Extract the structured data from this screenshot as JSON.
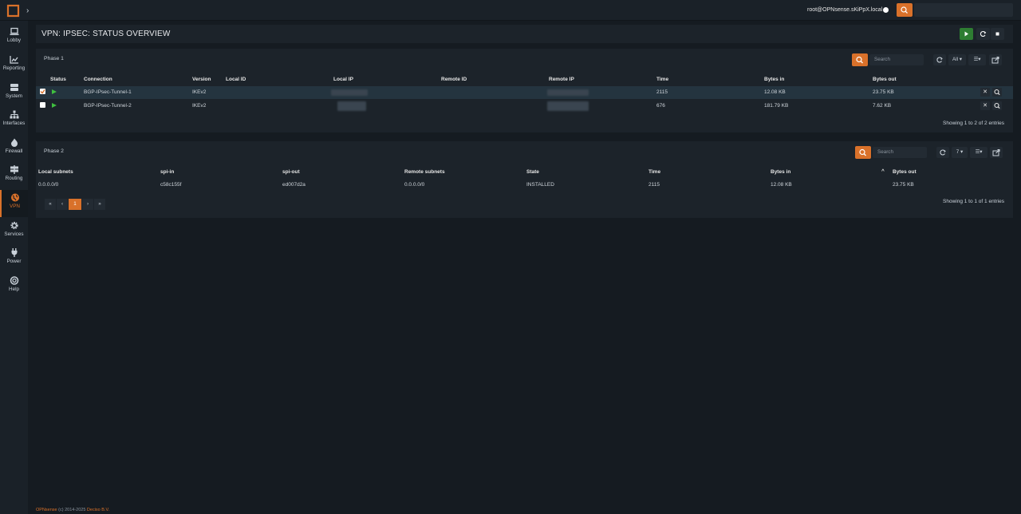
{
  "topbar": {
    "user": "root@OPNsense.sKiPpX.local",
    "search_placeholder": ""
  },
  "sidebar": {
    "items": [
      {
        "label": "Lobby",
        "icon": "laptop-icon"
      },
      {
        "label": "Reporting",
        "icon": "chart-icon"
      },
      {
        "label": "System",
        "icon": "server-icon"
      },
      {
        "label": "Interfaces",
        "icon": "sitemap-icon"
      },
      {
        "label": "Firewall",
        "icon": "fire-icon"
      },
      {
        "label": "Routing",
        "icon": "signpost-icon"
      },
      {
        "label": "VPN",
        "icon": "globe-icon"
      },
      {
        "label": "Services",
        "icon": "gear-icon"
      },
      {
        "label": "Power",
        "icon": "plug-icon"
      },
      {
        "label": "Help",
        "icon": "lifebuoy-icon"
      }
    ]
  },
  "page": {
    "title": "VPN: IPSEC: STATUS OVERVIEW"
  },
  "phase1": {
    "title": "Phase 1",
    "search_placeholder": "Search",
    "rows_filter": "All",
    "columns": [
      "Status",
      "Connection",
      "Version",
      "Local ID",
      "Local IP",
      "Remote ID",
      "Remote IP",
      "Time",
      "Bytes in",
      "Bytes out"
    ],
    "rows": [
      {
        "connection": "BGP-IPsec-Tunnel-1",
        "version": "IKEv2",
        "time": "2115",
        "bytes_in": "12.08 KB",
        "bytes_out": "23.75 KB",
        "selected": true
      },
      {
        "connection": "BGP-IPsec-Tunnel-2",
        "version": "IKEv2",
        "time": "676",
        "bytes_in": "181.79 KB",
        "bytes_out": "7.62 KB",
        "selected": false
      }
    ],
    "showing": "Showing 1 to 2 of 2 entries"
  },
  "phase2": {
    "title": "Phase 2",
    "search_placeholder": "Search",
    "rows_filter": "7",
    "columns": [
      "Local subnets",
      "spi-in",
      "spi-out",
      "Remote subnets",
      "State",
      "Time",
      "Bytes in",
      "Bytes out"
    ],
    "rows": [
      {
        "local_subnets": "0.0.0.0/0",
        "spi_in": "c58c155f",
        "spi_out": "ed007d2a",
        "remote_subnets": "0.0.0.0/0",
        "state": "INSTALLED",
        "time": "2115",
        "bytes_in": "12.08 KB",
        "bytes_out": "23.75 KB"
      }
    ],
    "pagination": {
      "first": "«",
      "prev": "‹",
      "current": "1",
      "next": "›",
      "last": "»"
    },
    "showing": "Showing 1 to 1 of 1 entries"
  },
  "footer": {
    "brand": "OPNsense",
    "text": " (c) 2014-2025 ",
    "company": "Deciso B.V."
  },
  "colors": {
    "accent": "#d9712a",
    "success": "#2e7d32",
    "background": "#151b21"
  }
}
